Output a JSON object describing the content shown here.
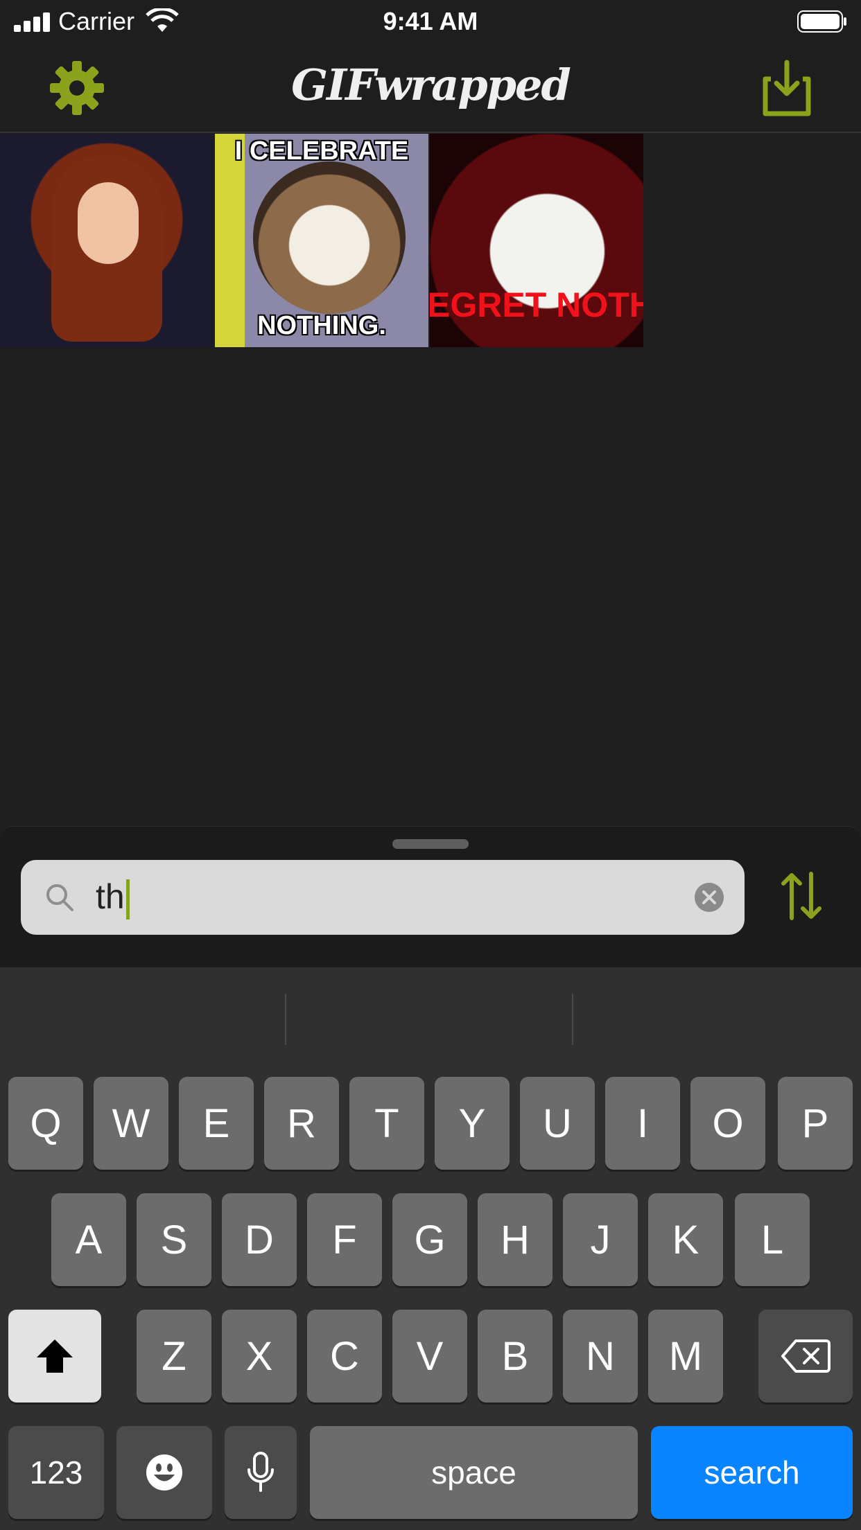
{
  "status_bar": {
    "carrier": "Carrier",
    "time": "9:41 AM"
  },
  "nav": {
    "title": "GIFwrapped",
    "settings_icon": "gear-icon",
    "import_icon": "tray-download-icon",
    "accent_color": "#8ba21c"
  },
  "gifs": [
    {
      "name": "woman-smiling-gif",
      "top_text": "",
      "bottom_text": ""
    },
    {
      "name": "grumpy-cat-gif",
      "top_text": "I CELEBRATE",
      "bottom_text": "NOTHING."
    },
    {
      "name": "chicken-gif",
      "top_text": "",
      "bottom_text": "EGRET NOTH"
    }
  ],
  "search": {
    "value": "th",
    "search_icon": "magnifier-icon",
    "clear_icon": "clear-circle-icon",
    "sort_icon": "sort-arrows-icon"
  },
  "keyboard": {
    "row1": [
      "Q",
      "W",
      "E",
      "R",
      "T",
      "Y",
      "U",
      "I",
      "O",
      "P"
    ],
    "row2": [
      "A",
      "S",
      "D",
      "F",
      "G",
      "H",
      "J",
      "K",
      "L"
    ],
    "row3": [
      "Z",
      "X",
      "C",
      "V",
      "B",
      "N",
      "M"
    ],
    "numbers_label": "123",
    "space_label": "space",
    "search_label": "search",
    "search_key_color": "#0a84ff"
  }
}
